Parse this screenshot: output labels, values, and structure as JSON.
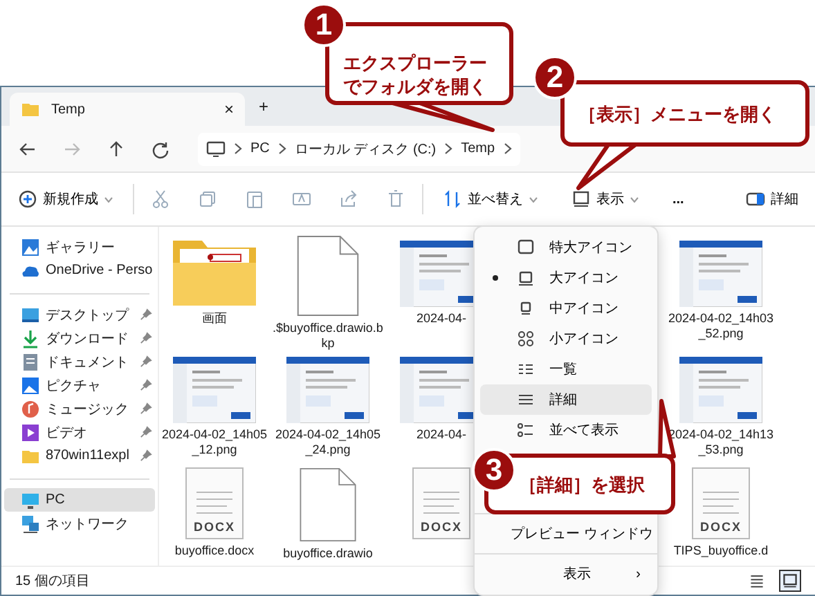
{
  "tab": {
    "title": "Temp",
    "close": "×",
    "new": "+"
  },
  "breadcrumb": [
    "PC",
    "ローカル ディスク (C:)",
    "Temp"
  ],
  "toolbar": {
    "new": "新規作成",
    "sort": "並べ替え",
    "view": "表示",
    "more": "...",
    "details": "詳細"
  },
  "sidebar": {
    "groups": [
      [
        {
          "label": "ギャラリー",
          "pinned": false,
          "selected": false
        },
        {
          "label": "OneDrive - Perso",
          "pinned": false,
          "selected": false
        }
      ],
      [
        {
          "label": "デスクトップ",
          "pinned": true,
          "selected": false
        },
        {
          "label": "ダウンロード",
          "pinned": true,
          "selected": false
        },
        {
          "label": "ドキュメント",
          "pinned": true,
          "selected": false
        },
        {
          "label": "ピクチャ",
          "pinned": true,
          "selected": false
        },
        {
          "label": "ミュージック",
          "pinned": true,
          "selected": false
        },
        {
          "label": "ビデオ",
          "pinned": true,
          "selected": false
        },
        {
          "label": "870win11expl",
          "pinned": true,
          "selected": false
        }
      ],
      [
        {
          "label": "PC",
          "pinned": false,
          "selected": true
        },
        {
          "label": "ネットワーク",
          "pinned": false,
          "selected": false
        }
      ]
    ]
  },
  "file_rows": [
    [
      {
        "kind": "folder",
        "name": "画面"
      },
      {
        "kind": "blank",
        "name": ".$buyoffice.drawio.bkp"
      },
      {
        "name": "2024-04-"
      },
      {
        "name": "2024-04-02_14h03_52.png"
      }
    ],
    [
      {
        "name": "2024-04-02_14h05_12.png"
      },
      {
        "name": "2024-04-02_14h05_24.png"
      },
      {
        "name": "2024-04-"
      },
      {
        "name": "2024-04-02_14h13_53.png"
      }
    ],
    [
      {
        "kind": "docx",
        "name": "buyoffice.docx",
        "badge": "DOCX"
      },
      {
        "kind": "blank",
        "name": "buyoffice.drawio"
      },
      {
        "kind": "docx",
        "badge": "DOCX"
      },
      {
        "kind": "docx",
        "name": "TIPS_buyoffice.d",
        "badge": "DOCX"
      }
    ]
  ],
  "menu": {
    "items": [
      {
        "label": "特大アイコン",
        "selected": false,
        "highlighted": false
      },
      {
        "label": "大アイコン",
        "selected": true,
        "highlighted": false
      },
      {
        "label": "中アイコン",
        "selected": false,
        "highlighted": false
      },
      {
        "label": "小アイコン",
        "selected": false,
        "highlighted": false
      },
      {
        "label": "一覧",
        "selected": false,
        "highlighted": false
      },
      {
        "label": "詳細",
        "selected": false,
        "highlighted": true
      },
      {
        "label": "並べて表示",
        "selected": false,
        "highlighted": false
      },
      {
        "label": "プレビュー ウィンドウ",
        "selected": false,
        "highlighted": false
      }
    ],
    "submenu": "表示",
    "submenu_arrow": "›"
  },
  "status_bar": {
    "count": "15 個の項目",
    "views": [
      {
        "selected": false
      },
      {
        "selected": true
      }
    ]
  },
  "callouts": [
    {
      "number": "1",
      "text": "エクスプローラーでフォルダを開く"
    },
    {
      "number": "2",
      "text": "［表示］メニューを開く"
    },
    {
      "number": "3",
      "text": "［詳細］を選択"
    }
  ]
}
